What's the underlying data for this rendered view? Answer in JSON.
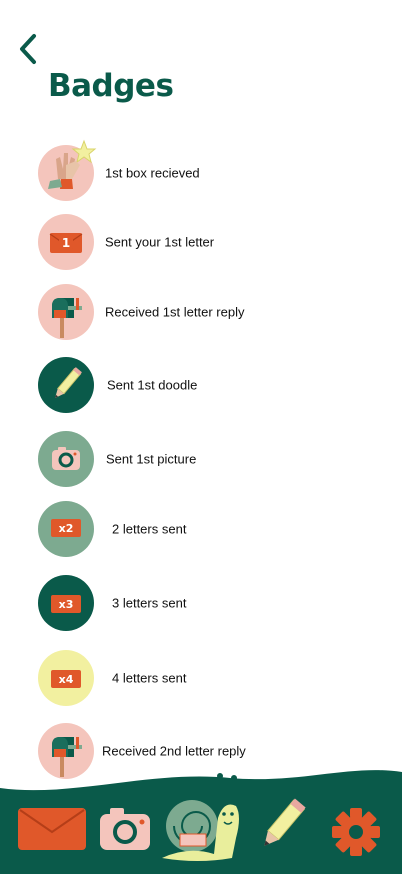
{
  "header": {
    "title": "Badges"
  },
  "badges": [
    {
      "label": "1st box recieved",
      "icon": "high-five-icon"
    },
    {
      "label": "Sent your 1st letter",
      "icon": "envelope-one-icon",
      "count": "1"
    },
    {
      "label": "Received 1st letter reply",
      "icon": "mailbox-icon"
    },
    {
      "label": "Sent 1st doodle",
      "icon": "pencil-icon"
    },
    {
      "label": "Sent 1st picture",
      "icon": "camera-icon"
    },
    {
      "label": "2 letters sent",
      "icon": "envelope-x2-icon",
      "count": "x2"
    },
    {
      "label": "3 letters sent",
      "icon": "envelope-x3-icon",
      "count": "x3"
    },
    {
      "label": "4 letters sent",
      "icon": "envelope-x4-icon",
      "count": "x4"
    },
    {
      "label": "Received 2nd letter reply",
      "icon": "mailbox-icon"
    }
  ],
  "bottom_nav": [
    {
      "icon": "envelope-icon"
    },
    {
      "icon": "camera-icon"
    },
    {
      "icon": "snail-icon"
    },
    {
      "icon": "pencil-icon"
    },
    {
      "icon": "gear-icon"
    }
  ],
  "colors": {
    "primary": "#0a5a4a",
    "accent": "#e0582a",
    "pink": "#f4c5bc",
    "sage": "#7daa90",
    "yellow": "#f2f0a0"
  }
}
